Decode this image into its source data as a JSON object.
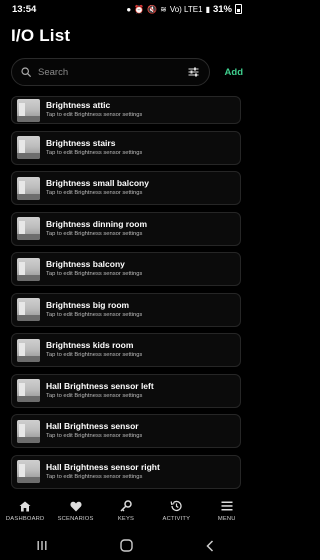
{
  "status": {
    "time": "13:54",
    "battery": "31%",
    "network": "Vo) LTE1"
  },
  "page": {
    "title": "I/O List"
  },
  "search": {
    "placeholder": "Search",
    "value": ""
  },
  "add_label": "Add",
  "items": [
    {
      "title": "Brightness attic",
      "subtitle": "Tap to edit Brightness sensor settings"
    },
    {
      "title": "Brightness stairs",
      "subtitle": "Tap to edit Brightness sensor settings"
    },
    {
      "title": "Brightness small balcony",
      "subtitle": "Tap to edit Brightness sensor settings"
    },
    {
      "title": "Brightness dinning room",
      "subtitle": "Tap to edit Brightness sensor settings"
    },
    {
      "title": "Brightness balcony",
      "subtitle": "Tap to edit Brightness sensor settings"
    },
    {
      "title": "Brightness big room",
      "subtitle": "Tap to edit Brightness sensor settings"
    },
    {
      "title": "Brightness kids room",
      "subtitle": "Tap to edit Brightness sensor settings"
    },
    {
      "title": "Hall Brightness  sensor left",
      "subtitle": "Tap to edit Brightness sensor settings"
    },
    {
      "title": "Hall Brightness sensor",
      "subtitle": "Tap to edit Brightness sensor settings"
    },
    {
      "title": "Hall Brightness sensor right",
      "subtitle": "Tap to edit Brightness sensor settings"
    }
  ],
  "nav": [
    {
      "label": "DASHBOARD",
      "icon": "home-icon"
    },
    {
      "label": "SCENARIOS",
      "icon": "heart-icon"
    },
    {
      "label": "KEYS",
      "icon": "key-icon"
    },
    {
      "label": "ACTIVITY",
      "icon": "history-icon"
    },
    {
      "label": "MENU",
      "icon": "menu-icon"
    }
  ],
  "colors": {
    "accent": "#3fcf8e",
    "background": "#000000"
  }
}
